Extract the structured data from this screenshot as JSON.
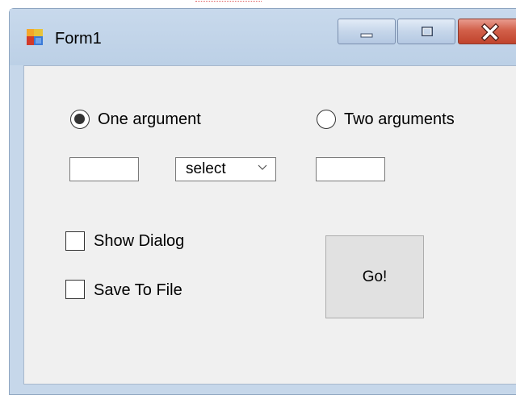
{
  "window": {
    "title": "Form1",
    "icon": "winforms-app-icon",
    "controls": {
      "minimize_icon": "minimize-icon",
      "maximize_icon": "maximize-icon",
      "close_icon": "close-icon"
    }
  },
  "form": {
    "radio_one": {
      "label": "One argument",
      "checked": true
    },
    "radio_two": {
      "label": "Two arguments",
      "checked": false
    },
    "textbox_one": {
      "value": ""
    },
    "operator_select": {
      "value": "select"
    },
    "textbox_two": {
      "value": ""
    },
    "show_dialog": {
      "label": "Show Dialog",
      "checked": false
    },
    "save_to_file": {
      "label": "Save To File",
      "checked": false
    },
    "go_button": {
      "label": "Go!"
    }
  },
  "colors": {
    "title_bar": "#c6d7ea",
    "client_area": "#f0f0f0",
    "close_button": "#c0432c",
    "button_face": "#e1e1e1"
  }
}
